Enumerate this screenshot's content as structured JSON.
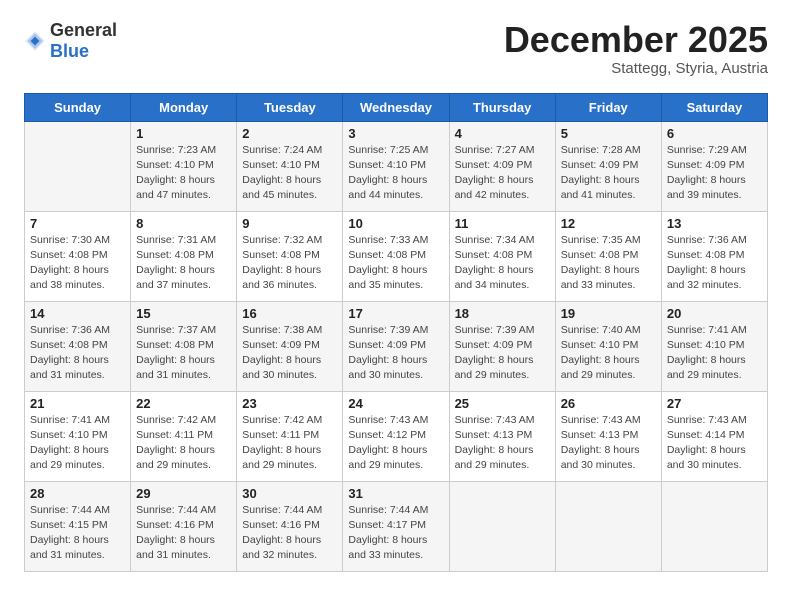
{
  "header": {
    "logo_general": "General",
    "logo_blue": "Blue",
    "month": "December 2025",
    "location": "Stattegg, Styria, Austria"
  },
  "days_of_week": [
    "Sunday",
    "Monday",
    "Tuesday",
    "Wednesday",
    "Thursday",
    "Friday",
    "Saturday"
  ],
  "weeks": [
    [
      {
        "day": "",
        "info": ""
      },
      {
        "day": "1",
        "info": "Sunrise: 7:23 AM\nSunset: 4:10 PM\nDaylight: 8 hours\nand 47 minutes."
      },
      {
        "day": "2",
        "info": "Sunrise: 7:24 AM\nSunset: 4:10 PM\nDaylight: 8 hours\nand 45 minutes."
      },
      {
        "day": "3",
        "info": "Sunrise: 7:25 AM\nSunset: 4:10 PM\nDaylight: 8 hours\nand 44 minutes."
      },
      {
        "day": "4",
        "info": "Sunrise: 7:27 AM\nSunset: 4:09 PM\nDaylight: 8 hours\nand 42 minutes."
      },
      {
        "day": "5",
        "info": "Sunrise: 7:28 AM\nSunset: 4:09 PM\nDaylight: 8 hours\nand 41 minutes."
      },
      {
        "day": "6",
        "info": "Sunrise: 7:29 AM\nSunset: 4:09 PM\nDaylight: 8 hours\nand 39 minutes."
      }
    ],
    [
      {
        "day": "7",
        "info": "Sunrise: 7:30 AM\nSunset: 4:08 PM\nDaylight: 8 hours\nand 38 minutes."
      },
      {
        "day": "8",
        "info": "Sunrise: 7:31 AM\nSunset: 4:08 PM\nDaylight: 8 hours\nand 37 minutes."
      },
      {
        "day": "9",
        "info": "Sunrise: 7:32 AM\nSunset: 4:08 PM\nDaylight: 8 hours\nand 36 minutes."
      },
      {
        "day": "10",
        "info": "Sunrise: 7:33 AM\nSunset: 4:08 PM\nDaylight: 8 hours\nand 35 minutes."
      },
      {
        "day": "11",
        "info": "Sunrise: 7:34 AM\nSunset: 4:08 PM\nDaylight: 8 hours\nand 34 minutes."
      },
      {
        "day": "12",
        "info": "Sunrise: 7:35 AM\nSunset: 4:08 PM\nDaylight: 8 hours\nand 33 minutes."
      },
      {
        "day": "13",
        "info": "Sunrise: 7:36 AM\nSunset: 4:08 PM\nDaylight: 8 hours\nand 32 minutes."
      }
    ],
    [
      {
        "day": "14",
        "info": "Sunrise: 7:36 AM\nSunset: 4:08 PM\nDaylight: 8 hours\nand 31 minutes."
      },
      {
        "day": "15",
        "info": "Sunrise: 7:37 AM\nSunset: 4:08 PM\nDaylight: 8 hours\nand 31 minutes."
      },
      {
        "day": "16",
        "info": "Sunrise: 7:38 AM\nSunset: 4:09 PM\nDaylight: 8 hours\nand 30 minutes."
      },
      {
        "day": "17",
        "info": "Sunrise: 7:39 AM\nSunset: 4:09 PM\nDaylight: 8 hours\nand 30 minutes."
      },
      {
        "day": "18",
        "info": "Sunrise: 7:39 AM\nSunset: 4:09 PM\nDaylight: 8 hours\nand 29 minutes."
      },
      {
        "day": "19",
        "info": "Sunrise: 7:40 AM\nSunset: 4:10 PM\nDaylight: 8 hours\nand 29 minutes."
      },
      {
        "day": "20",
        "info": "Sunrise: 7:41 AM\nSunset: 4:10 PM\nDaylight: 8 hours\nand 29 minutes."
      }
    ],
    [
      {
        "day": "21",
        "info": "Sunrise: 7:41 AM\nSunset: 4:10 PM\nDaylight: 8 hours\nand 29 minutes."
      },
      {
        "day": "22",
        "info": "Sunrise: 7:42 AM\nSunset: 4:11 PM\nDaylight: 8 hours\nand 29 minutes."
      },
      {
        "day": "23",
        "info": "Sunrise: 7:42 AM\nSunset: 4:11 PM\nDaylight: 8 hours\nand 29 minutes."
      },
      {
        "day": "24",
        "info": "Sunrise: 7:43 AM\nSunset: 4:12 PM\nDaylight: 8 hours\nand 29 minutes."
      },
      {
        "day": "25",
        "info": "Sunrise: 7:43 AM\nSunset: 4:13 PM\nDaylight: 8 hours\nand 29 minutes."
      },
      {
        "day": "26",
        "info": "Sunrise: 7:43 AM\nSunset: 4:13 PM\nDaylight: 8 hours\nand 30 minutes."
      },
      {
        "day": "27",
        "info": "Sunrise: 7:43 AM\nSunset: 4:14 PM\nDaylight: 8 hours\nand 30 minutes."
      }
    ],
    [
      {
        "day": "28",
        "info": "Sunrise: 7:44 AM\nSunset: 4:15 PM\nDaylight: 8 hours\nand 31 minutes."
      },
      {
        "day": "29",
        "info": "Sunrise: 7:44 AM\nSunset: 4:16 PM\nDaylight: 8 hours\nand 31 minutes."
      },
      {
        "day": "30",
        "info": "Sunrise: 7:44 AM\nSunset: 4:16 PM\nDaylight: 8 hours\nand 32 minutes."
      },
      {
        "day": "31",
        "info": "Sunrise: 7:44 AM\nSunset: 4:17 PM\nDaylight: 8 hours\nand 33 minutes."
      },
      {
        "day": "",
        "info": ""
      },
      {
        "day": "",
        "info": ""
      },
      {
        "day": "",
        "info": ""
      }
    ]
  ]
}
